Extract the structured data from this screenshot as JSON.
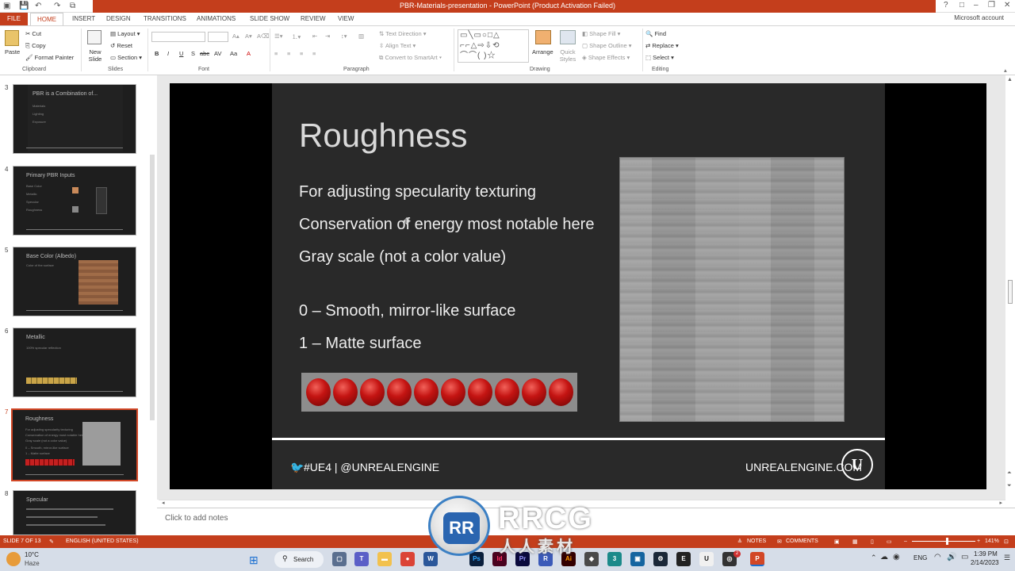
{
  "window": {
    "title": "PBR-Materials-presentation - PowerPoint (Product Activation Failed)",
    "account": "Microsoft account",
    "controls": [
      "?",
      "□",
      "–",
      "❐",
      "✕"
    ]
  },
  "tabs": [
    {
      "id": "file",
      "label": "FILE"
    },
    {
      "id": "home",
      "label": "HOME"
    },
    {
      "id": "insert",
      "label": "INSERT"
    },
    {
      "id": "design",
      "label": "DESIGN"
    },
    {
      "id": "transitions",
      "label": "TRANSITIONS"
    },
    {
      "id": "animations",
      "label": "ANIMATIONS"
    },
    {
      "id": "slideshow",
      "label": "SLIDE SHOW"
    },
    {
      "id": "review",
      "label": "REVIEW"
    },
    {
      "id": "view",
      "label": "VIEW"
    }
  ],
  "ribbon": {
    "clipboard": {
      "paste": "Paste",
      "cut": "Cut",
      "copy": "Copy",
      "format_painter": "Format Painter",
      "label": "Clipboard"
    },
    "slides": {
      "new_slide": "New Slide",
      "layout": "Layout",
      "reset": "Reset",
      "section": "Section",
      "label": "Slides"
    },
    "font": {
      "label": "Font",
      "buttons": [
        "B",
        "I",
        "U",
        "S",
        "abc",
        "AV",
        "Aa",
        "A"
      ]
    },
    "paragraph": {
      "label": "Paragraph",
      "text_direction": "Text Direction",
      "align_text": "Align Text",
      "convert_smartart": "Convert to SmartArt"
    },
    "drawing": {
      "label": "Drawing",
      "arrange": "Arrange",
      "quick_styles": "Quick Styles",
      "shape_fill": "Shape Fill",
      "shape_outline": "Shape Outline",
      "shape_effects": "Shape Effects"
    },
    "editing": {
      "label": "Editing",
      "find": "Find",
      "replace": "Replace",
      "select": "Select"
    }
  },
  "thumbnails": [
    {
      "num": "3",
      "title": "PBR is a Combination of...",
      "lines": [
        "Materials",
        "Lighting",
        "Exposure"
      ]
    },
    {
      "num": "4",
      "title": "Primary PBR Inputs",
      "lines": [
        "Base Color",
        "Metallic",
        "Specular",
        "Roughness"
      ]
    },
    {
      "num": "5",
      "title": "Base Color (Albedo)",
      "lines": [
        "Color of the surface",
        "",
        "",
        ""
      ]
    },
    {
      "num": "6",
      "title": "Metallic",
      "lines": [
        "100% specular reflection",
        "",
        "",
        ""
      ]
    },
    {
      "num": "7",
      "title": "Roughness",
      "lines": [
        "For adjusting specularity texturing",
        "Conservation of energy most notable here",
        "Gray scale (not a color value)",
        "0 – Smooth, mirror-like surface",
        "1 – Matte surface"
      ]
    },
    {
      "num": "8",
      "title": "Specular",
      "lines": [
        "",
        "",
        ""
      ]
    }
  ],
  "slide": {
    "title": "Roughness",
    "bullets": [
      "For adjusting specularity texturing",
      "Conservation of energy most notable here",
      "Gray scale (not a color value)",
      "0 – Smooth, mirror-like surface",
      "1 – Matte surface"
    ],
    "sphere_count": 10,
    "footer_left": "#UE4 | @UNREALENGINE",
    "footer_right": "UNREALENGINE.COM",
    "logo": "U"
  },
  "notes": {
    "placeholder": "Click to add notes"
  },
  "status": {
    "slide_info": "SLIDE 7 OF 13",
    "language": "ENGLISH (UNITED STATES)",
    "notes": "NOTES",
    "comments": "COMMENTS",
    "zoom": "141%"
  },
  "taskbar": {
    "weather_temp": "10°C",
    "weather_desc": "Haze",
    "search": "Search",
    "lang": "ENG",
    "time": "1:39 PM",
    "date": "2/14/2023",
    "notification_count": "2"
  },
  "watermark": {
    "text": "RRCG",
    "sub": "人人素材",
    "badge": "RR"
  }
}
